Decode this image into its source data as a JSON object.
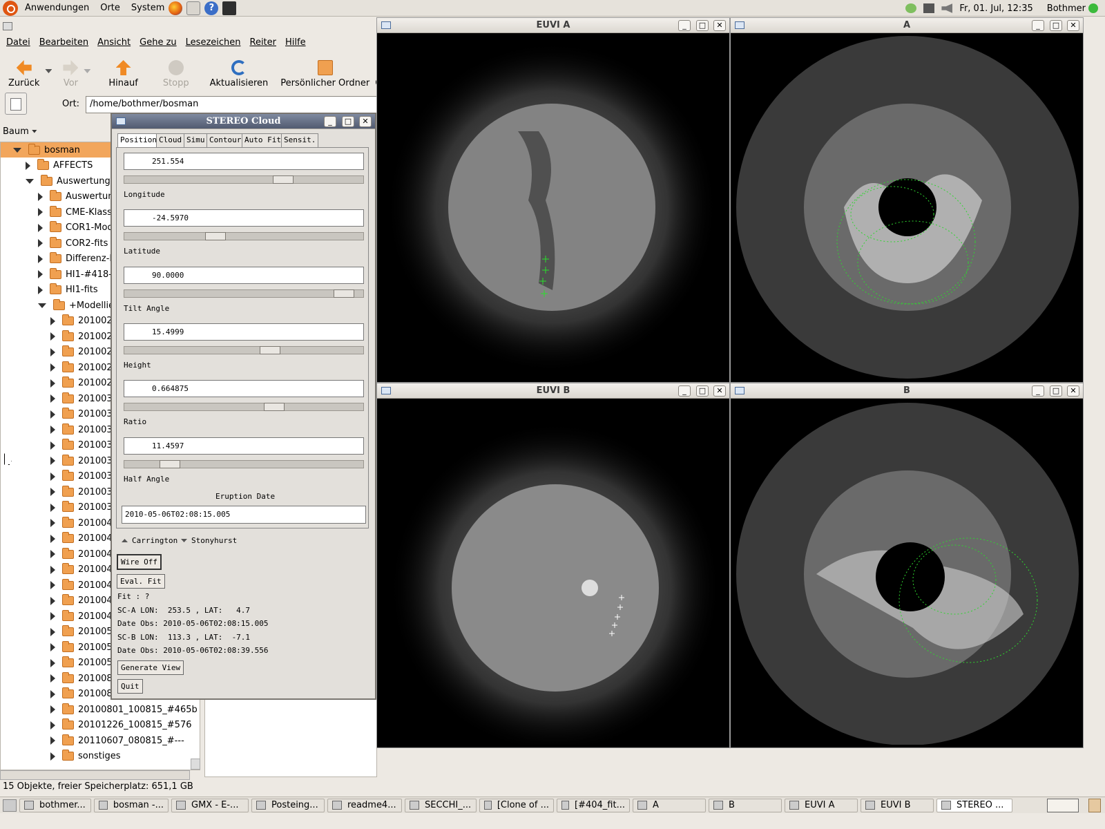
{
  "top_panel": {
    "menus": [
      "Anwendungen",
      "Orte",
      "System"
    ],
    "clock": "Fr, 01. Jul, 12:35",
    "user": "Bothmer"
  },
  "nautilus": {
    "menu": [
      "Datei",
      "Bearbeiten",
      "Ansicht",
      "Gehe zu",
      "Lesezeichen",
      "Reiter",
      "Hilfe"
    ],
    "toolbar": {
      "back": "Zurück",
      "forward": "Vor",
      "up": "Hinauf",
      "stop": "Stopp",
      "reload": "Aktualisieren",
      "home": "Persönlicher Ordner",
      "extra": "C"
    },
    "location_label": "Ort:",
    "location_value": "/home/bothmer/bosman",
    "side_mode": "Baum",
    "tree": [
      "bosman",
      "AFFECTS",
      "Auswertung",
      "Auswertung",
      "CME-Klasse",
      "COR1-Mode",
      "COR2-fits",
      "Differenz-Ir",
      "HI1-#418-F",
      "HI1-fits",
      "+Modellieru",
      "201002",
      "201002",
      "201002",
      "201002",
      "201002",
      "201003",
      "201003",
      "201003",
      "201003",
      "201003",
      "201003",
      "201003",
      "201003",
      "201004",
      "201004",
      "201004",
      "201004",
      "201004",
      "201004",
      "201004",
      "201005",
      "201005",
      "201005",
      "201008",
      "201008",
      "20100801_100815_#465b",
      "20101226_100815_#576",
      "20110607_080815_#---",
      "sonstiges"
    ],
    "status": "15 Objekte, freier Speicherplatz: 651,1 GB"
  },
  "windows": {
    "euvi_a": "EUVI A",
    "a": "A",
    "euvi_b": "EUVI B",
    "b": "B"
  },
  "cloud": {
    "title": "STEREO Cloud",
    "tabs": [
      "Position",
      "Cloud",
      "Simu",
      "Contour",
      "Auto Fit",
      "Sensit."
    ],
    "params": [
      {
        "value": "251.554",
        "label": "Longitude",
        "slider": 0.68
      },
      {
        "value": "-24.5970",
        "label": "Latitude",
        "slider": 0.37
      },
      {
        "value": "90.0000",
        "label": "Tilt Angle",
        "slider": 0.96
      },
      {
        "value": "15.4999",
        "label": "Height",
        "slider": 0.62
      },
      {
        "value": "0.664875",
        "label": "Ratio",
        "slider": 0.64
      },
      {
        "value": "11.4597",
        "label": "Half Angle",
        "slider": 0.16
      }
    ],
    "eruption_label": "Eruption Date",
    "eruption_value": "2010-05-06T02:08:15.005",
    "radio_carrington": "Carrington",
    "radio_stonyhurst": "Stonyhurst",
    "wire_btn": "Wire Off",
    "eval_btn": "Eval. Fit",
    "fit": "Fit : ?",
    "sca": "SC-A LON:  253.5 , LAT:   4.7",
    "date_a": "Date Obs: 2010-05-06T02:08:15.005",
    "scb": "SC-B LON:  113.3 , LAT:  -7.1",
    "date_b": "Date Obs: 2010-05-06T02:08:39.556",
    "gen_btn": "Generate View",
    "quit_btn": "Quit"
  },
  "taskbar": [
    "bothmer...",
    "bosman -...",
    "GMX - E-...",
    "Posteing...",
    "readme4...",
    "SECCHI_...",
    "[Clone of ...",
    "[#404_fit...",
    "A",
    "B",
    "EUVI A",
    "EUVI B",
    "STEREO ..."
  ]
}
